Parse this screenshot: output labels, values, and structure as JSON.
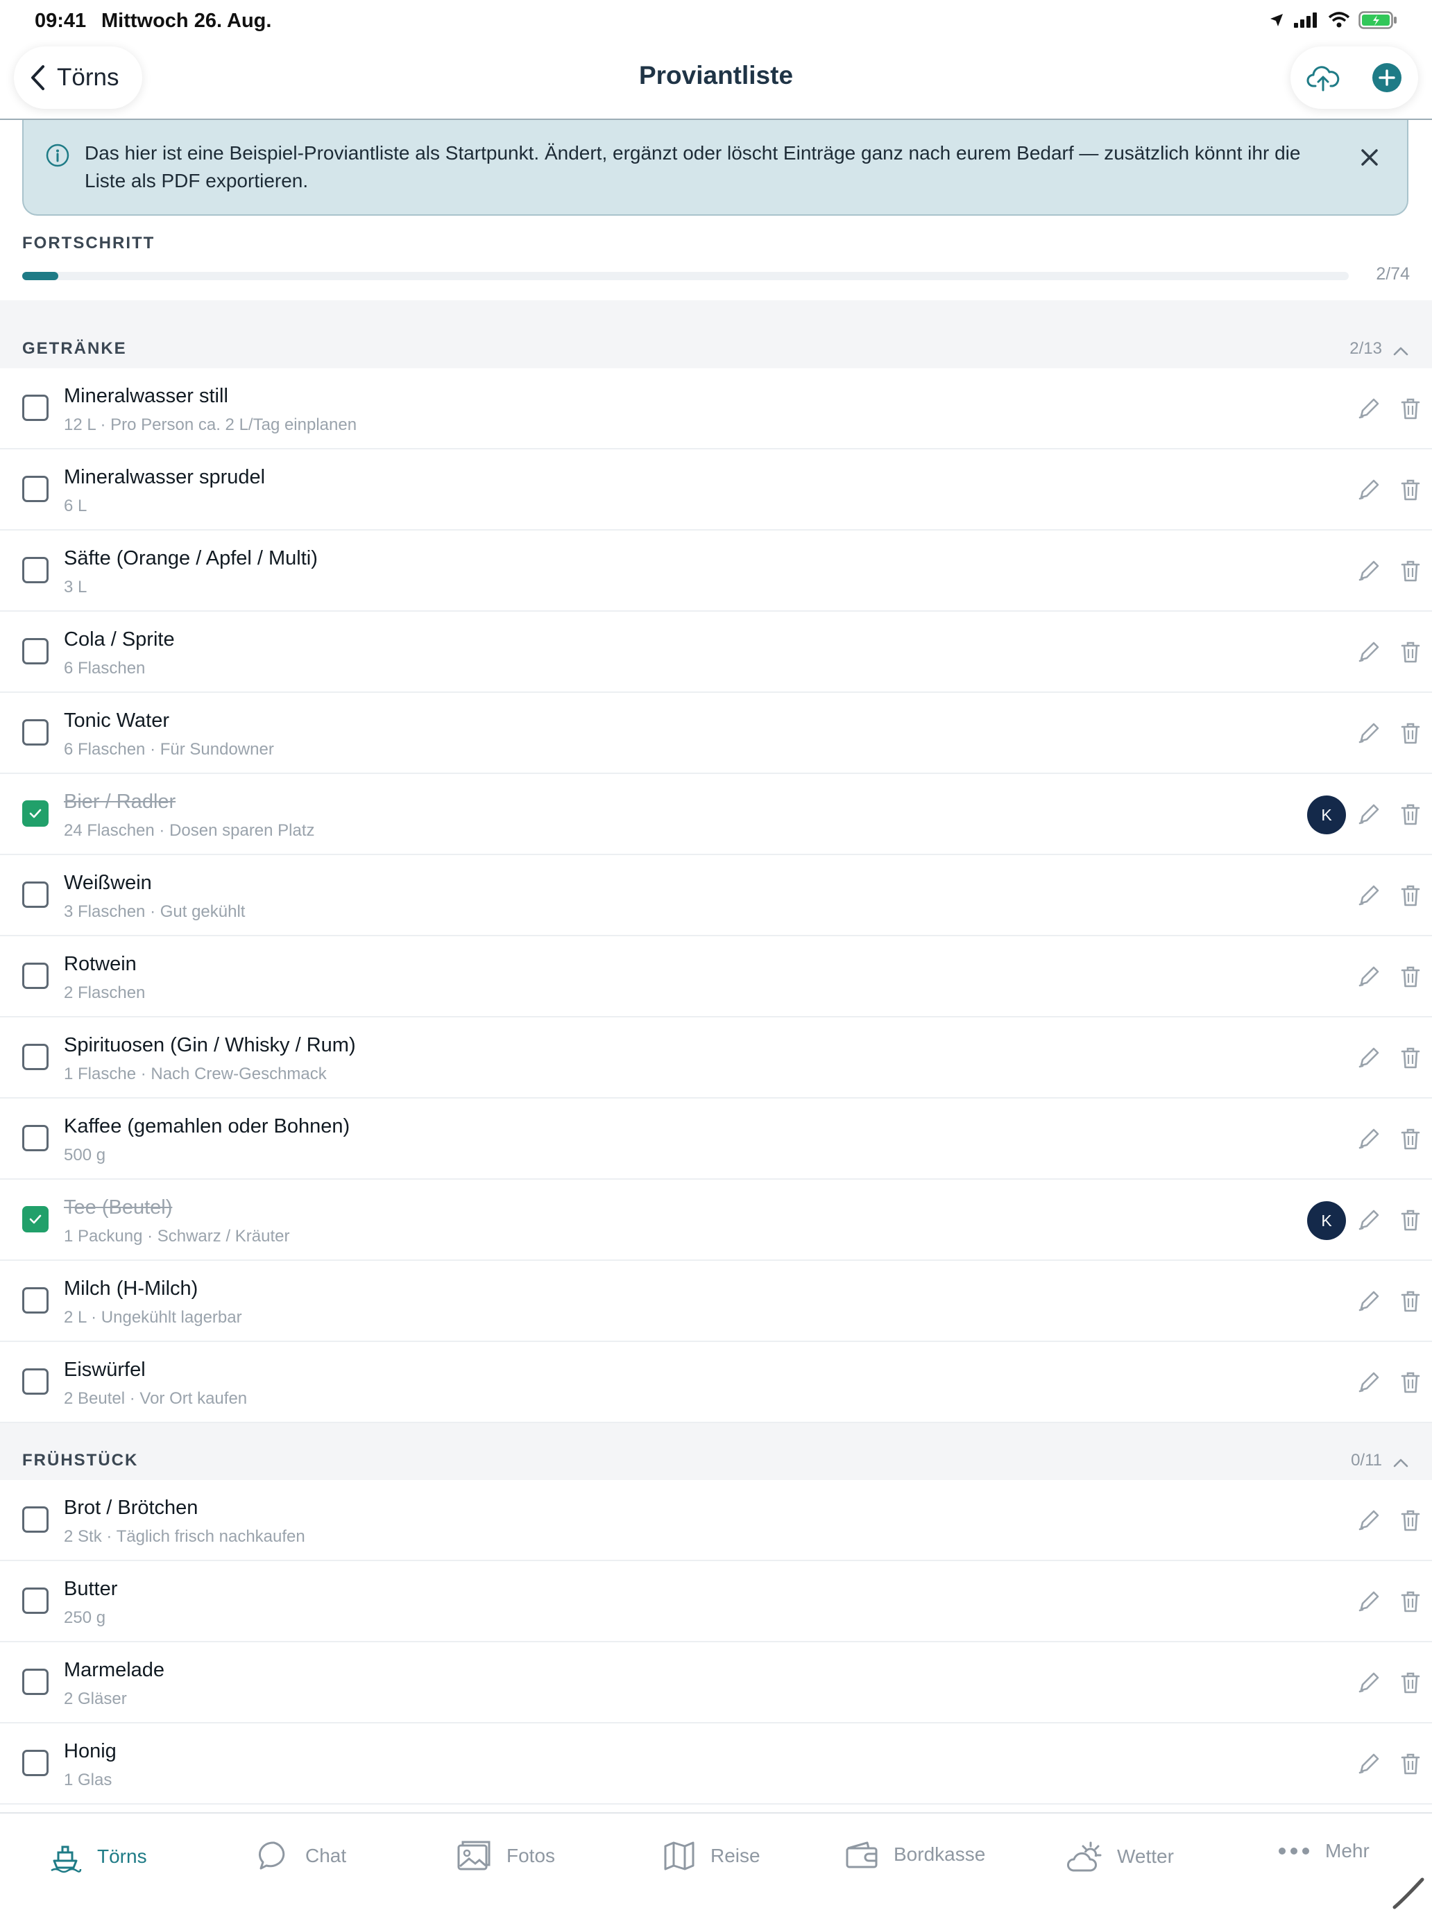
{
  "status_bar": {
    "time": "09:41",
    "date": "Mittwoch 26. Aug."
  },
  "header": {
    "back_label": "Törns",
    "title": "Proviantliste"
  },
  "banner": {
    "text": "Das hier ist eine Beispiel-Proviantliste als Startpunkt. Ändert, ergänzt oder löscht Einträge ganz nach eurem Bedarf — zusätzlich könnt ihr die Liste als PDF exportieren."
  },
  "progress": {
    "label": "FORTSCHRITT",
    "done": 2,
    "total": 74,
    "count": "2/74"
  },
  "sections": [
    {
      "title": "GETRÄNKE",
      "count": "2/13",
      "items": [
        {
          "name": "Mineralwasser still",
          "sub": "12 L · Pro Person ca. 2 L/Tag einplanen",
          "checked": false
        },
        {
          "name": "Mineralwasser sprudel",
          "sub": "6 L",
          "checked": false
        },
        {
          "name": "Säfte (Orange / Apfel / Multi)",
          "sub": "3 L",
          "checked": false
        },
        {
          "name": "Cola / Sprite",
          "sub": "6 Flaschen",
          "checked": false
        },
        {
          "name": "Tonic Water",
          "sub": "6 Flaschen · Für Sundowner",
          "checked": false
        },
        {
          "name": "Bier / Radler",
          "sub": "24 Flaschen · Dosen sparen Platz",
          "checked": true,
          "avatar": "K"
        },
        {
          "name": "Weißwein",
          "sub": "3 Flaschen · Gut gekühlt",
          "checked": false
        },
        {
          "name": "Rotwein",
          "sub": "2 Flaschen",
          "checked": false
        },
        {
          "name": "Spirituosen (Gin / Whisky / Rum)",
          "sub": "1 Flasche · Nach Crew-Geschmack",
          "checked": false
        },
        {
          "name": "Kaffee (gemahlen oder Bohnen)",
          "sub": "500 g",
          "checked": false
        },
        {
          "name": "Tee (Beutel)",
          "sub": "1 Packung · Schwarz / Kräuter",
          "checked": true,
          "avatar": "K"
        },
        {
          "name": "Milch (H-Milch)",
          "sub": "2 L · Ungekühlt lagerbar",
          "checked": false
        },
        {
          "name": "Eiswürfel",
          "sub": "2 Beutel · Vor Ort kaufen",
          "checked": false
        }
      ]
    },
    {
      "title": "FRÜHSTÜCK",
      "count": "0/11",
      "items": [
        {
          "name": "Brot / Brötchen",
          "sub": "2 Stk · Täglich frisch nachkaufen",
          "checked": false
        },
        {
          "name": "Butter",
          "sub": "250 g",
          "checked": false
        },
        {
          "name": "Marmelade",
          "sub": "2 Gläser",
          "checked": false
        },
        {
          "name": "Honig",
          "sub": "1 Glas",
          "checked": false
        }
      ]
    }
  ],
  "tabs": [
    {
      "label": "Törns",
      "icon": "ship-icon",
      "active": true
    },
    {
      "label": "Chat",
      "icon": "chat-bubble-icon",
      "active": false
    },
    {
      "label": "Fotos",
      "icon": "photos-icon",
      "active": false
    },
    {
      "label": "Reise",
      "icon": "map-icon",
      "active": false
    },
    {
      "label": "Bordkasse",
      "icon": "wallet-icon",
      "active": false
    },
    {
      "label": "Wetter",
      "icon": "weather-icon",
      "active": false
    },
    {
      "label": "Mehr",
      "icon": "more-dots-icon",
      "active": false
    }
  ],
  "colors": {
    "accent": "#1e7b86",
    "check": "#21a06a",
    "avatar": "#14294a",
    "banner_bg": "#d4e5ea"
  }
}
